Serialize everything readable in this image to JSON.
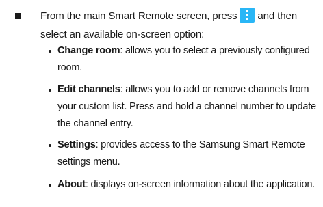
{
  "intro": {
    "text_before_icon": "From the main Smart Remote screen, press",
    "text_after_icon": "and then select an available on-screen option:",
    "icon": "menu-dots-icon",
    "icon_color": "#29b6f6"
  },
  "options": [
    {
      "term": "Change room",
      "description": ": allows you to select a previously configured room."
    },
    {
      "term": "Edit channels",
      "description": ": allows you to add or remove channels from your custom list. Press and hold a channel number to update the channel entry."
    },
    {
      "term": "Settings",
      "description": ": provides access to the Samsung Smart Remote settings menu."
    },
    {
      "term": "About",
      "description": ": displays on-screen information about the application."
    }
  ]
}
